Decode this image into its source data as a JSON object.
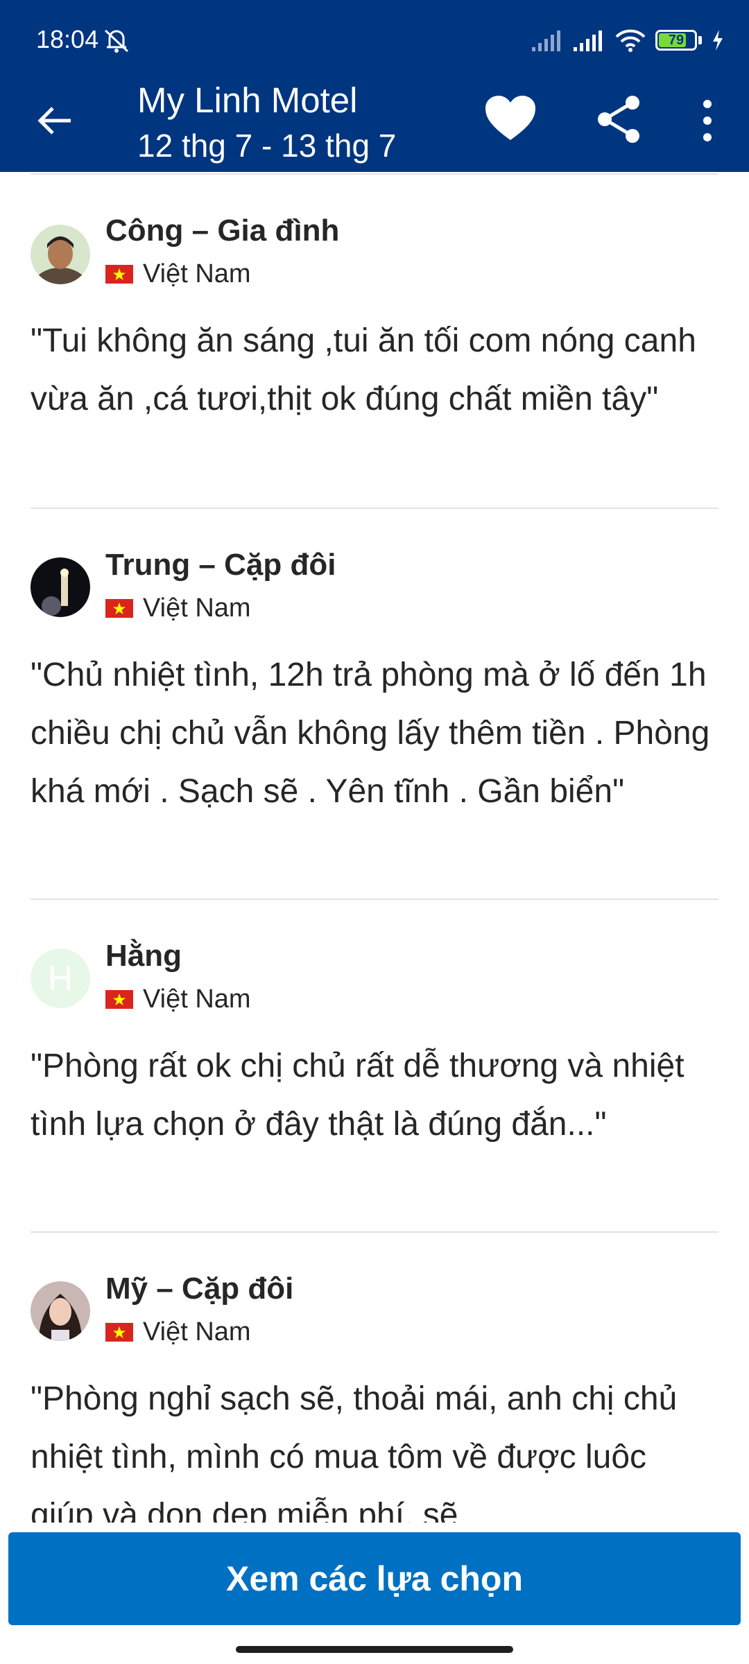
{
  "status_bar": {
    "time": "18:04",
    "battery_level": "79",
    "battery_fraction": 0.79
  },
  "header": {
    "title": "My Linh Motel",
    "dates": "12 thg 7 - 13 thg 7",
    "icons": [
      "back-arrow-icon",
      "heart-icon",
      "share-icon",
      "more-vertical-icon"
    ]
  },
  "reviews": [
    {
      "name": "Công – Gia đình",
      "country": "Việt Nam",
      "text": "\"Tui không ăn sáng ,tui ăn tối com nóng canh vừa ăn ,cá tươi,thịt ok đúng chất miền tây\"",
      "avatar_type": "photo"
    },
    {
      "name": "Trung – Cặp đôi",
      "country": "Việt Nam",
      "text": "\"Chủ nhiệt tình, 12h trả phòng mà ở lố đến 1h chiều chị chủ vẫn không lấy thêm tiền . Phòng khá mới . Sạch sẽ . Yên tĩnh . Gần biển\"",
      "avatar_type": "photo"
    },
    {
      "name": "Hằng",
      "country": "Việt Nam",
      "text": "\"Phòng rất ok chị chủ rất dễ thương và nhiệt tình lựa chọn ở đây thật là đúng đắn...\"",
      "avatar_initial": "H",
      "avatar_type": "initial"
    },
    {
      "name": "Mỹ – Cặp đôi",
      "country": "Việt Nam",
      "text": "\"Phòng nghỉ sạch sẽ, thoải mái, anh chị chủ nhiệt tình, mình có mua tôm về được luôc giúp và don dep miễn phí, sẽ",
      "avatar_type": "photo"
    }
  ],
  "cta": {
    "label": "Xem các lựa chọn"
  },
  "colors": {
    "header_bg": "#003580",
    "cta_bg": "#0071c2",
    "flag_red": "#da251d",
    "flag_star": "#ffff00",
    "avatar_initial_bg": "#e8f8e8"
  }
}
